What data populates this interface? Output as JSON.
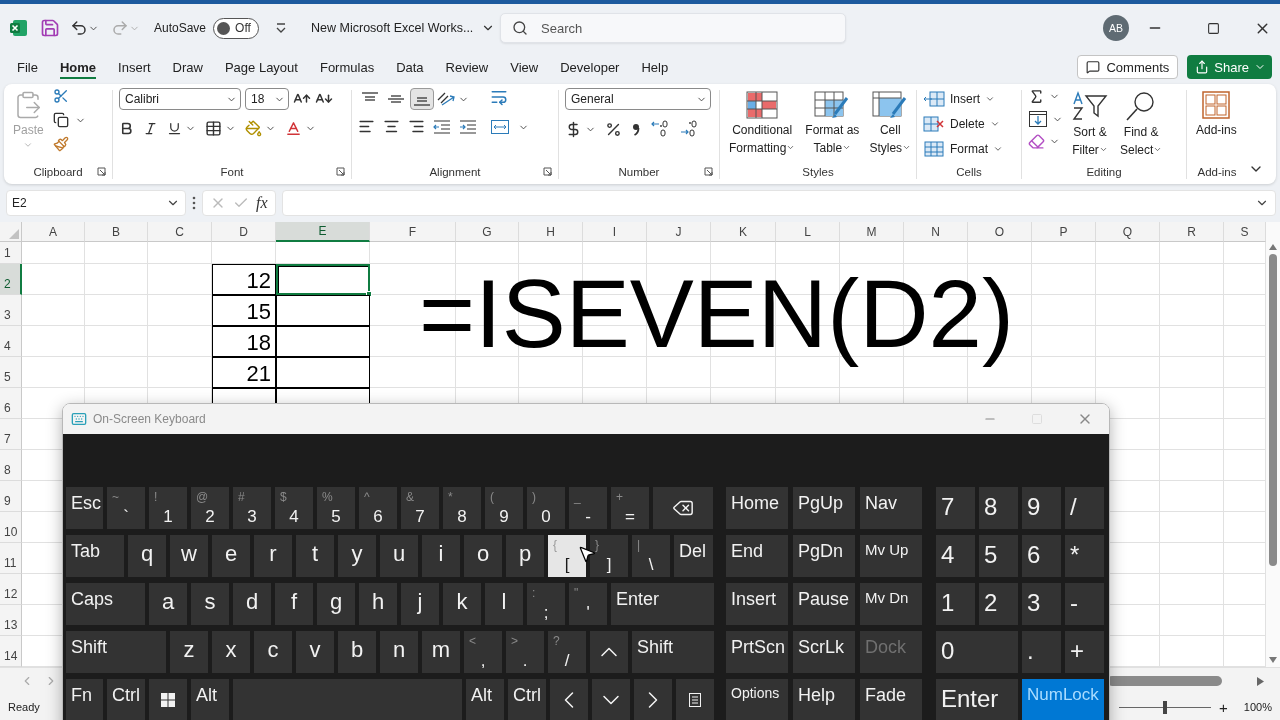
{
  "title_bar": {
    "autosave": {
      "label": "AutoSave",
      "toggle": {
        "on": false,
        "label": "Off"
      }
    },
    "document_title": "New Microsoft Excel Works...",
    "search": {
      "placeholder": "Search"
    },
    "avatar": "AB"
  },
  "menu": {
    "tabs": [
      {
        "label": "File",
        "selected": false
      },
      {
        "label": "Home",
        "selected": true
      },
      {
        "label": "Insert",
        "selected": false
      },
      {
        "label": "Draw",
        "selected": false
      },
      {
        "label": "Page Layout",
        "selected": false
      },
      {
        "label": "Formulas",
        "selected": false
      },
      {
        "label": "Data",
        "selected": false
      },
      {
        "label": "Review",
        "selected": false
      },
      {
        "label": "View",
        "selected": false
      },
      {
        "label": "Developer",
        "selected": false
      },
      {
        "label": "Help",
        "selected": false
      }
    ],
    "comments": "Comments",
    "share": "Share"
  },
  "ribbon": {
    "groups": [
      {
        "kind": "clipboard",
        "label": "Clipboard",
        "launcher": true,
        "paste": {
          "label": "Paste",
          "disabled": true
        }
      },
      {
        "kind": "font",
        "label": "Font",
        "launcher": true,
        "font_name": "Calibri",
        "font_size": "18"
      },
      {
        "kind": "alignment",
        "label": "Alignment",
        "launcher": true,
        "vertical_align": [
          {
            "selected": false
          },
          {
            "selected": false
          },
          {
            "selected": true
          }
        ]
      },
      {
        "kind": "number",
        "label": "Number",
        "launcher": true,
        "format": "General"
      },
      {
        "kind": "styles",
        "label": "Styles",
        "launcher": false,
        "buttons": [
          {
            "lines": [
              "Conditional",
              "Formatting"
            ]
          },
          {
            "lines": [
              "Format as",
              "Table"
            ]
          },
          {
            "lines": [
              "Cell",
              "Styles"
            ]
          }
        ]
      },
      {
        "kind": "cells",
        "label": "Cells",
        "launcher": false,
        "buttons": [
          "Insert",
          "Delete",
          "Format"
        ]
      },
      {
        "kind": "editing",
        "label": "Editing",
        "launcher": false,
        "buttons": [
          {
            "lines": [
              "Sort &",
              "Filter"
            ]
          },
          {
            "lines": [
              "Find &",
              "Select"
            ]
          }
        ]
      },
      {
        "kind": "addins",
        "label": "Add-ins",
        "launcher": false,
        "button": "Add-ins"
      }
    ]
  },
  "formula_bar": {
    "name_box": "E2",
    "fx": "fx"
  },
  "sheet": {
    "columns": [
      {
        "label": "A",
        "selected": false
      },
      {
        "label": "B",
        "selected": false
      },
      {
        "label": "C",
        "selected": false
      },
      {
        "label": "D",
        "selected": false
      },
      {
        "label": "E",
        "selected": true
      },
      {
        "label": "F",
        "selected": false
      },
      {
        "label": "G",
        "selected": false
      },
      {
        "label": "H",
        "selected": false
      },
      {
        "label": "I",
        "selected": false
      },
      {
        "label": "J",
        "selected": false
      },
      {
        "label": "K",
        "selected": false
      },
      {
        "label": "L",
        "selected": false
      },
      {
        "label": "M",
        "selected": false
      },
      {
        "label": "N",
        "selected": false
      },
      {
        "label": "O",
        "selected": false
      },
      {
        "label": "P",
        "selected": false
      },
      {
        "label": "Q",
        "selected": false
      },
      {
        "label": "R",
        "selected": false
      },
      {
        "label": "S",
        "selected": false
      }
    ],
    "rows": [
      {
        "label": "1",
        "selected": false
      },
      {
        "label": "2",
        "selected": true
      },
      {
        "label": "3",
        "selected": false
      },
      {
        "label": "4",
        "selected": false
      },
      {
        "label": "5",
        "selected": false
      },
      {
        "label": "6",
        "selected": false
      },
      {
        "label": "7",
        "selected": false
      },
      {
        "label": "8",
        "selected": false
      },
      {
        "label": "9",
        "selected": false
      },
      {
        "label": "10",
        "selected": false
      },
      {
        "label": "11",
        "selected": false
      },
      {
        "label": "12",
        "selected": false
      },
      {
        "label": "13",
        "selected": false
      },
      {
        "label": "14",
        "selected": false
      }
    ],
    "values": [
      "12",
      "15",
      "18",
      "21"
    ],
    "overlay_text": "=ISEVEN(D2)"
  },
  "status_bar": {
    "status": "Ready",
    "zoom": {
      "level": 0.5,
      "zoom_in": "+",
      "reading": "100%"
    }
  },
  "keyboard": {
    "title": "On-Screen Keyboard",
    "maximize_disabled": true,
    "main_rows": [
      [
        {
          "kind": "mod",
          "label": "Esc",
          "highlighted": false
        },
        {
          "kind": "sym",
          "shift": "~",
          "label": "`",
          "highlighted": false
        },
        {
          "kind": "sym",
          "shift": "!",
          "label": "1",
          "highlighted": false
        },
        {
          "kind": "sym",
          "shift": "@",
          "label": "2",
          "highlighted": false
        },
        {
          "kind": "sym",
          "shift": "#",
          "label": "3",
          "highlighted": false
        },
        {
          "kind": "sym",
          "shift": "$",
          "label": "4",
          "highlighted": false
        },
        {
          "kind": "sym",
          "shift": "%",
          "label": "5",
          "highlighted": false
        },
        {
          "kind": "sym",
          "shift": "^",
          "label": "6",
          "highlighted": false
        },
        {
          "kind": "sym",
          "shift": "&",
          "label": "7",
          "highlighted": false
        },
        {
          "kind": "sym",
          "shift": "*",
          "label": "8",
          "highlighted": false
        },
        {
          "kind": "sym",
          "shift": "(",
          "label": "9",
          "highlighted": false
        },
        {
          "kind": "sym",
          "shift": ")",
          "label": "0",
          "highlighted": false
        },
        {
          "kind": "sym",
          "shift": "_",
          "label": "-",
          "highlighted": false
        },
        {
          "kind": "sym",
          "shift": "+",
          "label": "=",
          "highlighted": false
        },
        {
          "kind": "icon",
          "highlighted": false
        }
      ],
      [
        {
          "kind": "mod",
          "label": "Tab",
          "highlighted": false
        },
        {
          "kind": "char",
          "label": "q",
          "highlighted": false
        },
        {
          "kind": "char",
          "label": "w",
          "highlighted": false
        },
        {
          "kind": "char",
          "label": "e",
          "highlighted": false
        },
        {
          "kind": "char",
          "label": "r",
          "highlighted": false
        },
        {
          "kind": "char",
          "label": "t",
          "highlighted": false
        },
        {
          "kind": "char",
          "label": "y",
          "highlighted": false
        },
        {
          "kind": "char",
          "label": "u",
          "highlighted": false
        },
        {
          "kind": "char",
          "label": "i",
          "highlighted": false
        },
        {
          "kind": "char",
          "label": "o",
          "highlighted": false
        },
        {
          "kind": "char",
          "label": "p",
          "highlighted": false
        },
        {
          "kind": "sym",
          "shift": "{",
          "label": "[",
          "highlighted": true
        },
        {
          "kind": "sym",
          "shift": "}",
          "label": "]",
          "highlighted": false
        },
        {
          "kind": "sym",
          "shift": "|",
          "label": "\\",
          "highlighted": false
        },
        {
          "kind": "mod",
          "label": "Del",
          "highlighted": false
        }
      ],
      [
        {
          "kind": "mod",
          "label": "Caps",
          "highlighted": false
        },
        {
          "kind": "char",
          "label": "a",
          "highlighted": false
        },
        {
          "kind": "char",
          "label": "s",
          "highlighted": false
        },
        {
          "kind": "char",
          "label": "d",
          "highlighted": false
        },
        {
          "kind": "char",
          "label": "f",
          "highlighted": false
        },
        {
          "kind": "char",
          "label": "g",
          "highlighted": false
        },
        {
          "kind": "char",
          "label": "h",
          "highlighted": false
        },
        {
          "kind": "char",
          "label": "j",
          "highlighted": false
        },
        {
          "kind": "char",
          "label": "k",
          "highlighted": false
        },
        {
          "kind": "char",
          "label": "l",
          "highlighted": false
        },
        {
          "kind": "sym",
          "shift": ":",
          "label": ";",
          "highlighted": false
        },
        {
          "kind": "sym",
          "shift": "\"",
          "label": "'",
          "highlighted": false
        },
        {
          "kind": "mod",
          "label": "Enter",
          "highlighted": false
        }
      ],
      [
        {
          "kind": "mod",
          "label": "Shift",
          "highlighted": false
        },
        {
          "kind": "char",
          "label": "z",
          "highlighted": false
        },
        {
          "kind": "char",
          "label": "x",
          "highlighted": false
        },
        {
          "kind": "char",
          "label": "c",
          "highlighted": false
        },
        {
          "kind": "char",
          "label": "v",
          "highlighted": false
        },
        {
          "kind": "char",
          "label": "b",
          "highlighted": false
        },
        {
          "kind": "char",
          "label": "n",
          "highlighted": false
        },
        {
          "kind": "char",
          "label": "m",
          "highlighted": false
        },
        {
          "kind": "sym",
          "shift": "<",
          "label": ",",
          "highlighted": false
        },
        {
          "kind": "sym",
          "shift": ">",
          "label": ".",
          "highlighted": false
        },
        {
          "kind": "sym",
          "shift": "?",
          "label": "/",
          "highlighted": false
        },
        {
          "kind": "icon",
          "highlighted": false
        },
        {
          "kind": "mod",
          "label": "Shift",
          "highlighted": false
        }
      ],
      [
        {
          "kind": "mod",
          "label": "Fn",
          "highlighted": false
        },
        {
          "kind": "mod",
          "label": "Ctrl",
          "highlighted": false
        },
        {
          "kind": "icon",
          "highlighted": false
        },
        {
          "kind": "mod",
          "label": "Alt",
          "highlighted": false
        },
        {
          "kind": "blank",
          "highlighted": false
        },
        {
          "kind": "mod",
          "label": "Alt",
          "highlighted": false
        },
        {
          "kind": "mod",
          "label": "Ctrl",
          "highlighted": false
        },
        {
          "kind": "icon",
          "highlighted": false
        },
        {
          "kind": "icon",
          "highlighted": false
        },
        {
          "kind": "icon",
          "highlighted": false
        },
        {
          "kind": "icon",
          "highlighted": false
        }
      ]
    ],
    "nav_rows": [
      [
        {
          "kind": "mod",
          "label": "Home",
          "disabled": false
        },
        {
          "kind": "mod",
          "label": "PgUp",
          "disabled": false
        },
        {
          "kind": "mod",
          "label": "Nav",
          "disabled": false
        }
      ],
      [
        {
          "kind": "mod",
          "label": "End",
          "disabled": false
        },
        {
          "kind": "mod",
          "label": "PgDn",
          "disabled": false
        },
        {
          "kind": "mod",
          "label": "Mv Up",
          "disabled": false
        }
      ],
      [
        {
          "kind": "mod",
          "label": "Insert",
          "disabled": false
        },
        {
          "kind": "mod",
          "label": "Pause",
          "disabled": false
        },
        {
          "kind": "mod",
          "label": "Mv Dn",
          "disabled": false
        }
      ],
      [
        {
          "kind": "mod",
          "label": "PrtScn",
          "disabled": false
        },
        {
          "kind": "mod",
          "label": "ScrLk",
          "disabled": false
        },
        {
          "kind": "mod",
          "label": "Dock",
          "disabled": true
        }
      ],
      [
        {
          "kind": "mod",
          "label": "Options",
          "disabled": false
        },
        {
          "kind": "mod",
          "label": "Help",
          "disabled": false
        },
        {
          "kind": "mod",
          "label": "Fade",
          "disabled": false
        }
      ]
    ],
    "numpad_rows": [
      [
        {
          "kind": "mod",
          "label": "7",
          "on": false
        },
        {
          "kind": "mod",
          "label": "8",
          "on": false
        },
        {
          "kind": "mod",
          "label": "9",
          "on": false
        },
        {
          "kind": "mod",
          "label": "/",
          "on": false
        }
      ],
      [
        {
          "kind": "mod",
          "label": "4",
          "on": false
        },
        {
          "kind": "mod",
          "label": "5",
          "on": false
        },
        {
          "kind": "mod",
          "label": "6",
          "on": false
        },
        {
          "kind": "mod",
          "label": "*",
          "on": false
        }
      ],
      [
        {
          "kind": "mod",
          "label": "1",
          "on": false
        },
        {
          "kind": "mod",
          "label": "2",
          "on": false
        },
        {
          "kind": "mod",
          "label": "3",
          "on": false
        },
        {
          "kind": "mod",
          "label": "-",
          "on": false
        }
      ],
      [
        {
          "kind": "mod",
          "label": "0",
          "on": false
        },
        {
          "kind": "mod",
          "label": ".",
          "on": false
        },
        {
          "kind": "mod",
          "label": "+",
          "on": false
        }
      ],
      [
        {
          "kind": "mod",
          "label": "Enter",
          "on": false
        },
        {
          "kind": "mod",
          "label": "NumLock",
          "on": true
        }
      ]
    ]
  }
}
